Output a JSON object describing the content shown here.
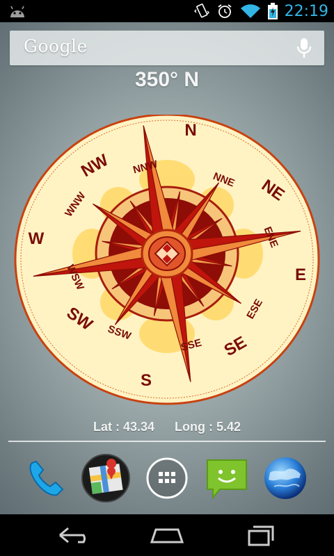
{
  "status_bar": {
    "time": "22:19",
    "icons": [
      "android-icon",
      "vibrate-icon",
      "alarm-icon",
      "wifi-icon",
      "battery-charging-icon"
    ]
  },
  "search": {
    "logo_text": "Google",
    "icon": "mic-icon"
  },
  "compass": {
    "heading": "350° N",
    "cardinal": [
      "N",
      "E",
      "S",
      "W"
    ],
    "intercardinal": [
      "NE",
      "SE",
      "SW",
      "NW"
    ],
    "minor": [
      "NNE",
      "ENE",
      "ESE",
      "SSE",
      "SSW",
      "WSW",
      "WNW",
      "NNW"
    ]
  },
  "location": {
    "lat_label": "Lat : 43.34",
    "long_label": "Long : 5.42"
  },
  "dock": {
    "items": [
      "phone-icon",
      "maps-icon",
      "all-apps-icon",
      "messaging-icon",
      "browser-icon"
    ]
  },
  "nav": {
    "items": [
      "back-icon",
      "home-icon",
      "recent-apps-icon"
    ]
  },
  "colors": {
    "accent": "#33b5e5",
    "compass_face": "#fff3c4",
    "rose_dark": "#c0150c",
    "rose_light": "#f08a3c"
  }
}
